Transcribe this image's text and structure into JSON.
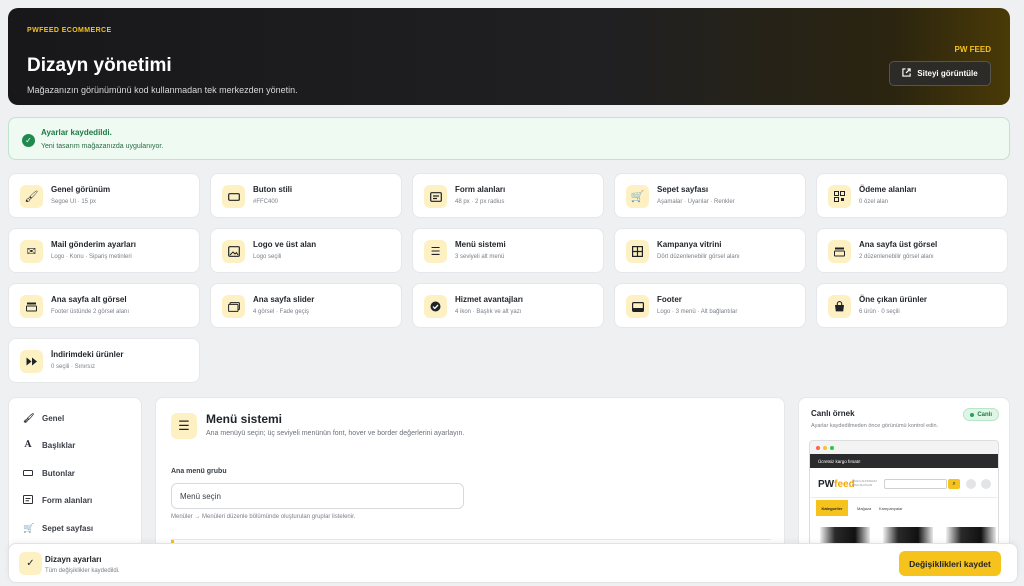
{
  "header": {
    "eyebrow": "PWFEED ECOMMERCE",
    "title": "Dizayn yönetimi",
    "subtitle": "Mağazanızın görünümünü kod kullanmadan tek merkezden yönetin.",
    "brand": "PW FEED",
    "view_site_label": "Siteyi görüntüle"
  },
  "alert": {
    "title": "Ayarlar kaydedildi.",
    "message": "Yeni tasarım mağazanızda uygulanıyor."
  },
  "cards": [
    {
      "title": "Genel görünüm",
      "sub": "Segoe UI · 15 px",
      "icon": "brush-icon"
    },
    {
      "title": "Buton stili",
      "sub": "#FFC400",
      "icon": "button-icon"
    },
    {
      "title": "Form alanları",
      "sub": "48 px · 2 px radius",
      "icon": "form-icon"
    },
    {
      "title": "Sepet sayfası",
      "sub": "Aşamalar · Uyarılar · Renkler",
      "icon": "cart-icon"
    },
    {
      "title": "Ödeme alanları",
      "sub": "0 özel alan",
      "icon": "qr-icon"
    },
    {
      "title": "Mail gönderim ayarları",
      "sub": "Logo · Konu · Sipariş metinleri",
      "icon": "mail-icon"
    },
    {
      "title": "Logo ve üst alan",
      "sub": "Logo seçili",
      "icon": "image-icon"
    },
    {
      "title": "Menü sistemi",
      "sub": "3 seviyeli alt menü",
      "icon": "menu-icon"
    },
    {
      "title": "Kampanya vitrini",
      "sub": "Dört düzenlenebilir görsel alanı",
      "icon": "grid-icon"
    },
    {
      "title": "Ana sayfa üst görsel",
      "sub": "2 düzenlenebilir görsel alanı",
      "icon": "stack-icon"
    },
    {
      "title": "Ana sayfa alt görsel",
      "sub": "Footer üstünde 2 görsel alanı",
      "icon": "stack-icon"
    },
    {
      "title": "Ana sayfa slider",
      "sub": "4 görsel · Fade geçiş",
      "icon": "slider-icon"
    },
    {
      "title": "Hizmet avantajları",
      "sub": "4 ikon · Başlık ve alt yazı",
      "icon": "check-circle-icon"
    },
    {
      "title": "Footer",
      "sub": "Logo · 3 menü · Alt bağlantılar",
      "icon": "footer-icon"
    },
    {
      "title": "Öne çıkan ürünler",
      "sub": "6 ürün · 0 seçili",
      "icon": "bag-icon"
    },
    {
      "title": "İndirimdeki ürünler",
      "sub": "0 seçili · Sınırsız",
      "icon": "fast-forward-icon"
    }
  ],
  "sidebar": {
    "items": [
      {
        "label": "Genel",
        "icon": "brush-icon"
      },
      {
        "label": "Başlıklar",
        "icon": "heading-icon"
      },
      {
        "label": "Butonlar",
        "icon": "button-icon"
      },
      {
        "label": "Form alanları",
        "icon": "form-icon"
      },
      {
        "label": "Sepet sayfası",
        "icon": "cart-icon"
      }
    ]
  },
  "panel": {
    "title": "Menü sistemi",
    "subtitle": "Ana menüyü seçin; üç seviyeli menünün font, hover ve border değerlerini ayarlayın.",
    "field_label": "Ana menü grubu",
    "select_value": "Menü seçin",
    "hint": "Menüler → Menüleri düzenle bölümünde oluşturulan gruplar listelenir."
  },
  "live": {
    "title": "Canlı örnek",
    "badge": "Canlı",
    "subtitle": "Ayarlar kaydedilmeden önce görünümü kontrol edin.",
    "mock": {
      "top_strip": "Ücretsiz kargo fırsatı!",
      "logo_pw": "PW",
      "logo_feed": "feed",
      "tagline": "LOGO ALTINDAKİ KISA SLOGAN",
      "nav_primary": "Kategoriler",
      "nav_2": "Mağaza",
      "nav_3": "Kampanyalar"
    }
  },
  "footer": {
    "title": "Dizayn ayarları",
    "subtitle": "Tüm değişiklikler kaydedildi.",
    "save_label": "Değişiklikleri kaydet"
  },
  "colors": {
    "accent": "#F6C21C",
    "success": "#1F8A4C",
    "dark": "#18181A"
  }
}
